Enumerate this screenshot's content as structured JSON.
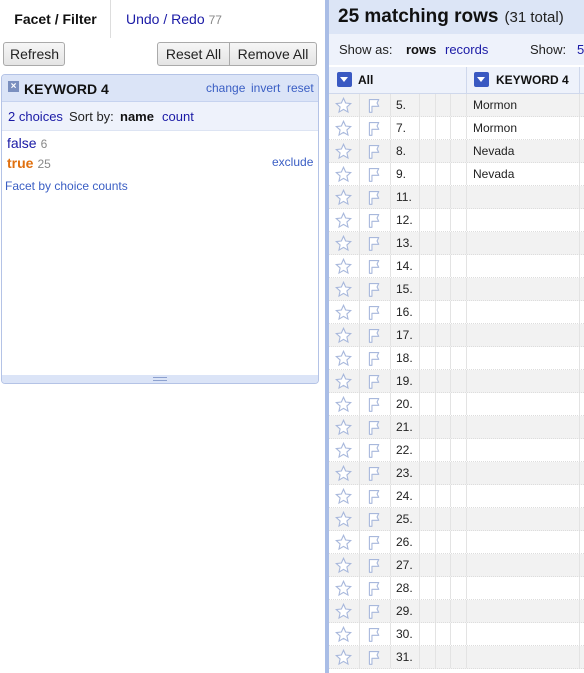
{
  "tabs": {
    "facet_filter": "Facet / Filter",
    "undo_redo": "Undo / Redo",
    "undo_count": "77"
  },
  "buttons": {
    "refresh": "Refresh",
    "reset_all": "Reset All",
    "remove_all": "Remove All"
  },
  "facet": {
    "close": "×",
    "title": "KEYWORD 4",
    "links": {
      "change": "change",
      "invert": "invert",
      "reset": "reset"
    },
    "choices_count": "2 choices",
    "sort_by": "Sort by:",
    "sort_name": "name",
    "sort_count": "count",
    "items": [
      {
        "label": "false",
        "count": "6",
        "selected": false
      },
      {
        "label": "true",
        "count": "25",
        "selected": true,
        "action": "exclude"
      }
    ],
    "facet_by_counts": "Facet by choice counts"
  },
  "summary": {
    "matching": "25 matching rows",
    "total": "(31 total)"
  },
  "view": {
    "show_as": "Show as:",
    "rows": "rows",
    "records": "records",
    "show": "Show:",
    "show_value": "5"
  },
  "columns": {
    "all": "All",
    "keyword4": "KEYWORD 4"
  },
  "rows": [
    {
      "num": "5.",
      "keyword": "Mormon"
    },
    {
      "num": "7.",
      "keyword": "Mormon"
    },
    {
      "num": "8.",
      "keyword": "Nevada"
    },
    {
      "num": "9.",
      "keyword": "Nevada"
    },
    {
      "num": "11.",
      "keyword": ""
    },
    {
      "num": "12.",
      "keyword": ""
    },
    {
      "num": "13.",
      "keyword": ""
    },
    {
      "num": "14.",
      "keyword": ""
    },
    {
      "num": "15.",
      "keyword": ""
    },
    {
      "num": "16.",
      "keyword": ""
    },
    {
      "num": "17.",
      "keyword": ""
    },
    {
      "num": "18.",
      "keyword": ""
    },
    {
      "num": "19.",
      "keyword": ""
    },
    {
      "num": "20.",
      "keyword": ""
    },
    {
      "num": "21.",
      "keyword": ""
    },
    {
      "num": "22.",
      "keyword": ""
    },
    {
      "num": "23.",
      "keyword": ""
    },
    {
      "num": "24.",
      "keyword": ""
    },
    {
      "num": "25.",
      "keyword": ""
    },
    {
      "num": "26.",
      "keyword": ""
    },
    {
      "num": "27.",
      "keyword": ""
    },
    {
      "num": "28.",
      "keyword": ""
    },
    {
      "num": "29.",
      "keyword": ""
    },
    {
      "num": "30.",
      "keyword": ""
    },
    {
      "num": "31.",
      "keyword": ""
    }
  ],
  "colors": {
    "accent": "#3a59c2",
    "header_bg": "#dce5f6",
    "true_choice": "#e0700f",
    "link": "#1a1aa6"
  }
}
